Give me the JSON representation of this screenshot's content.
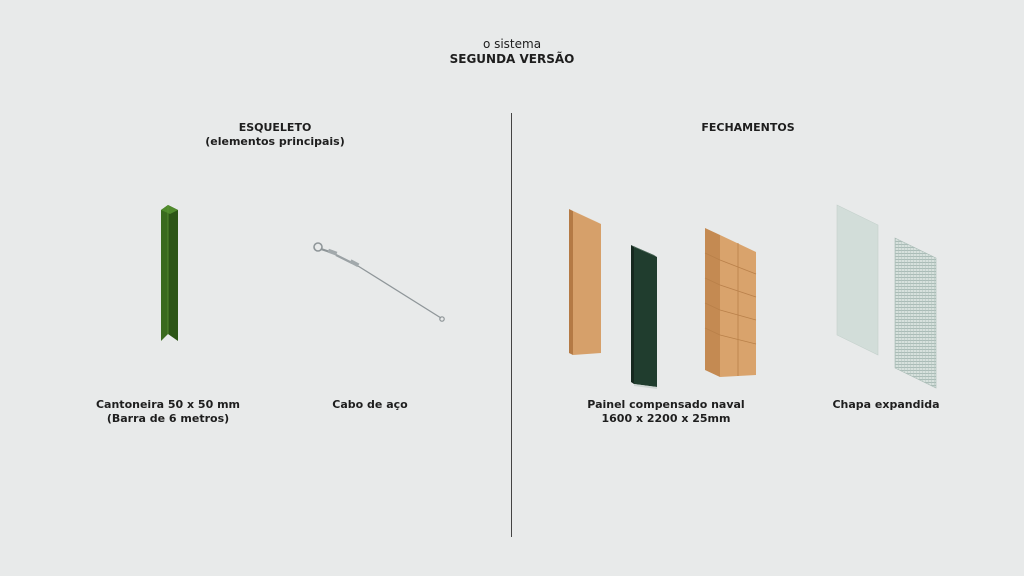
{
  "header": {
    "line1": "o sistema",
    "line2": "SEGUNDA VERSÃO"
  },
  "sections": {
    "left": {
      "title": "ESQUELETO",
      "subtitle": "(elementos principais)"
    },
    "right": {
      "title": "FECHAMENTOS"
    }
  },
  "items": {
    "cantoneira": {
      "line1": "Cantoneira 50 x 50 mm",
      "line2": "(Barra de 6 metros)"
    },
    "cabo": {
      "line1": "Cabo de aço"
    },
    "painel": {
      "line1": "Painel compensado naval",
      "line2": "1600 x 2200 x 25mm"
    },
    "chapa": {
      "line1": "Chapa expandida"
    }
  },
  "colors": {
    "background": "#e8eaea",
    "steel_green": "#3f6b22",
    "plywood": "#d29a63",
    "dark_panel": "#1f3a2c",
    "mesh": "#b9c9c4"
  }
}
